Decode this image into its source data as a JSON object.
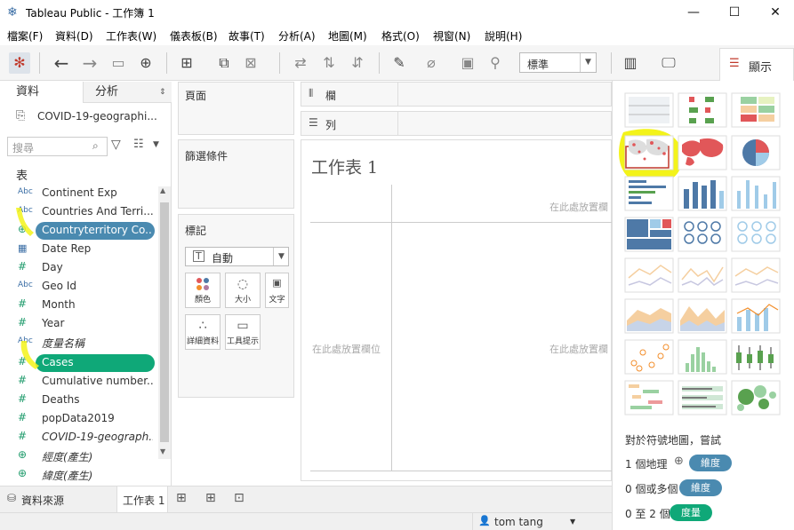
{
  "window": {
    "title": "Tableau Public - 工作簿 1",
    "min_glyph": "—",
    "max_glyph": "☐",
    "close_glyph": "✕"
  },
  "menu": [
    "檔案(F)",
    "資料(D)",
    "工作表(W)",
    "儀表板(B)",
    "故事(T)",
    "分析(A)",
    "地圖(M)",
    "格式(O)",
    "視窗(N)",
    "說明(H)"
  ],
  "toolbar": {
    "fit_value": "標準",
    "showme_label": "顯示"
  },
  "left_panel": {
    "tab_data": "資料",
    "tab_analytics": "分析",
    "datasource": "COVID-19-geographi...",
    "search_placeholder": "搜尋",
    "section_label": "表",
    "fields": [
      {
        "type": "Abc",
        "label": "Continent Exp"
      },
      {
        "type": "Abc",
        "label": "Countries And Terri..."
      },
      {
        "type": "geo",
        "label": "Countryterritory Co..."
      },
      {
        "type": "date",
        "label": "Date Rep"
      },
      {
        "type": "#",
        "label": "Day"
      },
      {
        "type": "Abc",
        "label": "Geo Id"
      },
      {
        "type": "#",
        "label": "Month"
      },
      {
        "type": "#",
        "label": "Year"
      },
      {
        "type": "Abc",
        "label": "度量名稱"
      },
      {
        "type": "#",
        "label": "Cases"
      },
      {
        "type": "#",
        "label": "Cumulative number..."
      },
      {
        "type": "#",
        "label": "Deaths"
      },
      {
        "type": "#",
        "label": "popData2019"
      },
      {
        "type": "#",
        "label": "COVID-19-geograph..."
      },
      {
        "type": "geo",
        "label": "經度(產生)"
      },
      {
        "type": "geo",
        "label": "緯度(產生)"
      }
    ]
  },
  "shelves": {
    "pages": "頁面",
    "columns": "欄",
    "rows": "列",
    "filters": "篩選條件",
    "marks": "標記",
    "mark_type": "自動",
    "mark_buttons": [
      "顏色",
      "大小",
      "文字",
      "詳細資料",
      "工具提示"
    ]
  },
  "canvas": {
    "sheet_title": "工作表 1",
    "drop_field_top": "在此處放置欄",
    "drop_field_left": "在此處放置欄位",
    "drop_field_center": "在此處放置欄"
  },
  "showme": {
    "hint_title": "對於符號地圖，嘗試",
    "req1_prefix": "1 個地理",
    "req1_tag": "維度",
    "req2_prefix": "0 個或多個",
    "req2_tag": "維度",
    "req3_prefix": "0 至 2 個",
    "req3_tag": "度量"
  },
  "bottom": {
    "datasource_tab": "資料來源",
    "sheet_tab": "工作表 1"
  },
  "status": {
    "user": "tom tang"
  },
  "colors": {
    "dimension_pill": "#4a8ab0",
    "measure_pill": "#0fa878",
    "highlight": "#f3f31a"
  }
}
